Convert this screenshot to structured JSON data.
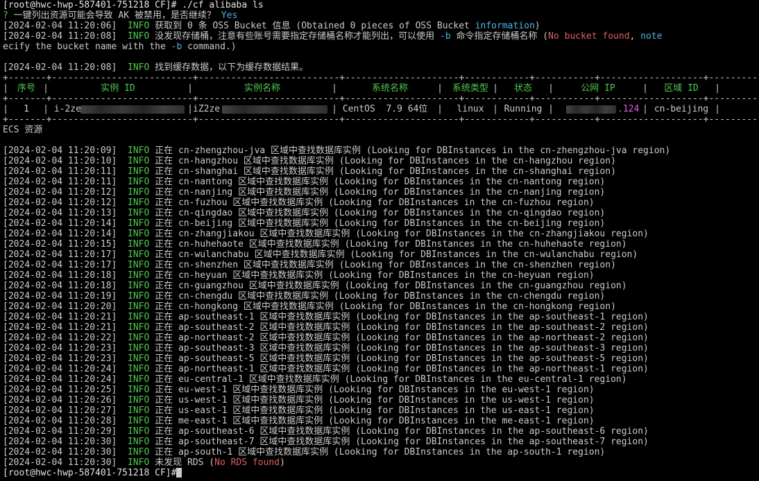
{
  "prompt": {
    "text": "[root@hwc-hwp-587401-751218 CF]#",
    "command": " ./cf alibaba ls"
  },
  "confirm": {
    "mark": "?",
    "question": " 一键列出资源可能会导致 AK 被禁用，是否继续？",
    "answer": " Yes"
  },
  "oss_line": {
    "time": "[2024-02-04 11:20:06]",
    "level": "INFO",
    "text": " 获取到 0 条 OSS Bucket 信息 (Obtained 0 pieces of OSS Bucket ",
    "highlight": "information",
    "tail": ")"
  },
  "bucket_line": {
    "time": "[2024-02-04 11:20:08]",
    "level": "INFO",
    "text": " 没发现存储桶，注意有些账号需要指定存储桶名称才能列出，可以使用 ",
    "flag": "-b",
    "text2": " 命令指定存储桶名称 (",
    "red": "No bucket found",
    "comma": ", ",
    "note": "note",
    "wrap": "ecify the bucket name with the ",
    "wrap_flag": "-b",
    "wrap_tail": " command.)"
  },
  "cache_line": {
    "time": "[2024-02-04 11:20:08]",
    "level": "INFO",
    "text": " 找到缓存数据，以下为缓存数据结果。"
  },
  "table": {
    "border": "+-------+--------------------------+--------------------------+---------------------+------------+-----------+-------------------+------------+",
    "headers": [
      "序号",
      "实例 ID",
      "实例名称",
      "系统名称",
      "系统类型",
      "状态",
      "公网 IP",
      "区域 ID"
    ],
    "row": {
      "index": "1",
      "instance_id": "i-2ze",
      "instance_name": "iZ2ze",
      "os_name": "CentOS  7.9 64位",
      "os_type": "linux",
      "status": "Running",
      "ip_suffix": ".124",
      "region": "cn-beijing"
    }
  },
  "ecs_label": "ECS 资源",
  "log_lines": [
    {
      "time": "[2024-02-04 11:20:09]",
      "level": "INFO",
      "text": " 正在 cn-zhengzhou-jva 区域中查找数据库实例 (Looking for DBInstances in the cn-zhengzhou-jva region)"
    },
    {
      "time": "[2024-02-04 11:20:10]",
      "level": "INFO",
      "text": " 正在 cn-hangzhou 区域中查找数据库实例 (Looking for DBInstances in the cn-hangzhou region)"
    },
    {
      "time": "[2024-02-04 11:20:11]",
      "level": "INFO",
      "text": " 正在 cn-shanghai 区域中查找数据库实例 (Looking for DBInstances in the cn-shanghai region)"
    },
    {
      "time": "[2024-02-04 11:20:11]",
      "level": "INFO",
      "text": " 正在 cn-nantong 区域中查找数据库实例 (Looking for DBInstances in the cn-nantong region)"
    },
    {
      "time": "[2024-02-04 11:20:12]",
      "level": "INFO",
      "text": " 正在 cn-nanjing 区域中查找数据库实例 (Looking for DBInstances in the cn-nanjing region)"
    },
    {
      "time": "[2024-02-04 11:20:12]",
      "level": "INFO",
      "text": " 正在 cn-fuzhou 区域中查找数据库实例 (Looking for DBInstances in the cn-fuzhou region)"
    },
    {
      "time": "[2024-02-04 11:20:13]",
      "level": "INFO",
      "text": " 正在 cn-qingdao 区域中查找数据库实例 (Looking for DBInstances in the cn-qingdao region)"
    },
    {
      "time": "[2024-02-04 11:20:14]",
      "level": "INFO",
      "text": " 正在 cn-beijing 区域中查找数据库实例 (Looking for DBInstances in the cn-beijing region)"
    },
    {
      "time": "[2024-02-04 11:20:14]",
      "level": "INFO",
      "text": " 正在 cn-zhangjiakou 区域中查找数据库实例 (Looking for DBInstances in the cn-zhangjiakou region)"
    },
    {
      "time": "[2024-02-04 11:20:15]",
      "level": "INFO",
      "text": " 正在 cn-huhehaote 区域中查找数据库实例 (Looking for DBInstances in the cn-huhehaote region)"
    },
    {
      "time": "[2024-02-04 11:20:17]",
      "level": "INFO",
      "text": " 正在 cn-wulanchabu 区域中查找数据库实例 (Looking for DBInstances in the cn-wulanchabu region)"
    },
    {
      "time": "[2024-02-04 11:20:17]",
      "level": "INFO",
      "text": " 正在 cn-shenzhen 区域中查找数据库实例 (Looking for DBInstances in the cn-shenzhen region)"
    },
    {
      "time": "[2024-02-04 11:20:18]",
      "level": "INFO",
      "text": " 正在 cn-heyuan 区域中查找数据库实例 (Looking for DBInstances in the cn-heyuan region)"
    },
    {
      "time": "[2024-02-04 11:20:18]",
      "level": "INFO",
      "text": " 正在 cn-guangzhou 区域中查找数据库实例 (Looking for DBInstances in the cn-guangzhou region)"
    },
    {
      "time": "[2024-02-04 11:20:19]",
      "level": "INFO",
      "text": " 正在 cn-chengdu 区域中查找数据库实例 (Looking for DBInstances in the cn-chengdu region)"
    },
    {
      "time": "[2024-02-04 11:20:20]",
      "level": "INFO",
      "text": " 正在 cn-hongkong 区域中查找数据库实例 (Looking for DBInstances in the cn-hongkong region)"
    },
    {
      "time": "[2024-02-04 11:20:21]",
      "level": "INFO",
      "text": " 正在 ap-southeast-1 区域中查找数据库实例 (Looking for DBInstances in the ap-southeast-1 region)"
    },
    {
      "time": "[2024-02-04 11:20:21]",
      "level": "INFO",
      "text": " 正在 ap-southeast-2 区域中查找数据库实例 (Looking for DBInstances in the ap-southeast-2 region)"
    },
    {
      "time": "[2024-02-04 11:20:22]",
      "level": "INFO",
      "text": " 正在 ap-northeast-2 区域中查找数据库实例 (Looking for DBInstances in the ap-northeast-2 region)"
    },
    {
      "time": "[2024-02-04 11:20:23]",
      "level": "INFO",
      "text": " 正在 ap-southeast-3 区域中查找数据库实例 (Looking for DBInstances in the ap-southeast-3 region)"
    },
    {
      "time": "[2024-02-04 11:20:23]",
      "level": "INFO",
      "text": " 正在 ap-southeast-5 区域中查找数据库实例 (Looking for DBInstances in the ap-southeast-5 region)"
    },
    {
      "time": "[2024-02-04 11:20:24]",
      "level": "INFO",
      "text": " 正在 ap-northeast-1 区域中查找数据库实例 (Looking for DBInstances in the ap-northeast-1 region)"
    },
    {
      "time": "[2024-02-04 11:20:24]",
      "level": "INFO",
      "text": " 正在 eu-central-1 区域中查找数据库实例 (Looking for DBInstances in the eu-central-1 region)"
    },
    {
      "time": "[2024-02-04 11:20:25]",
      "level": "INFO",
      "text": " 正在 eu-west-1 区域中查找数据库实例 (Looking for DBInstances in the eu-west-1 region)"
    },
    {
      "time": "[2024-02-04 11:20:26]",
      "level": "INFO",
      "text": " 正在 us-west-1 区域中查找数据库实例 (Looking for DBInstances in the us-west-1 region)"
    },
    {
      "time": "[2024-02-04 11:20:27]",
      "level": "INFO",
      "text": " 正在 us-east-1 区域中查找数据库实例 (Looking for DBInstances in the us-east-1 region)"
    },
    {
      "time": "[2024-02-04 11:20:28]",
      "level": "INFO",
      "text": " 正在 me-east-1 区域中查找数据库实例 (Looking for DBInstances in the me-east-1 region)"
    },
    {
      "time": "[2024-02-04 11:20:29]",
      "level": "INFO",
      "text": " 正在 ap-southeast-6 区域中查找数据库实例 (Looking for DBInstances in the ap-southeast-6 region)"
    },
    {
      "time": "[2024-02-04 11:20:30]",
      "level": "INFO",
      "text": " 正在 ap-southeast-7 区域中查找数据库实例 (Looking for DBInstances in the ap-southeast-7 region)"
    },
    {
      "time": "[2024-02-04 11:20:30]",
      "level": "INFO",
      "text": " 正在 ap-south-1 区域中查找数据库实例 (Looking for DBInstances in the ap-south-1 region)"
    }
  ],
  "rds_line": {
    "time": "[2024-02-04 11:20:30]",
    "level": "INFO",
    "text": " 未发现 RDS (",
    "red": "No RDS found",
    "tail": ")"
  },
  "final_prompt": "[root@hwc-hwp-587401-751218 CF]#",
  "colors": {
    "background": "#000000",
    "text": "#cccccc",
    "info": "#4fc94f",
    "error": "#e06060",
    "link": "#4fb6e6",
    "ip": "#e05ce0"
  }
}
